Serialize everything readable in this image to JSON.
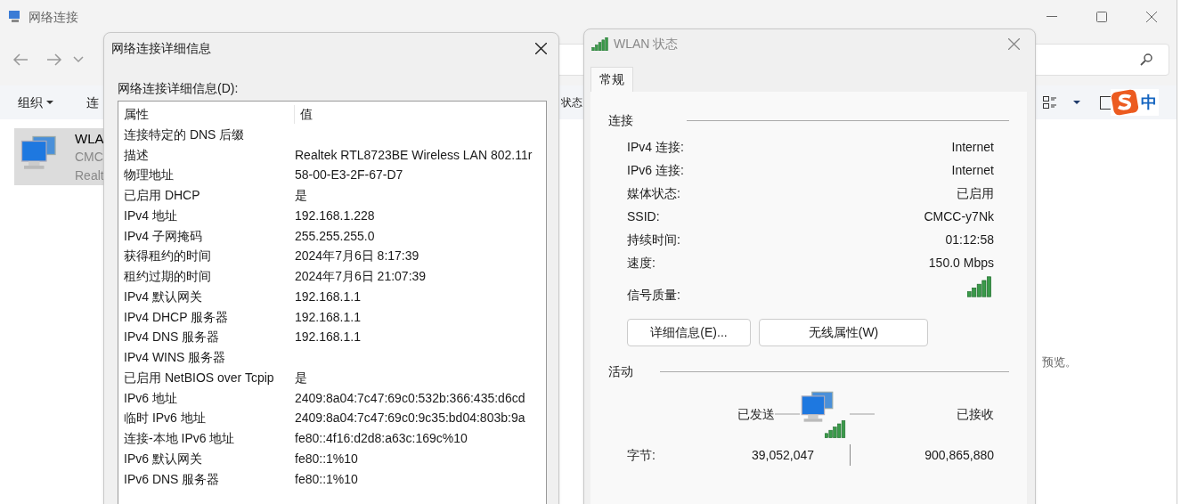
{
  "explorer": {
    "title": "网络连接",
    "toolbar": [
      {
        "label": "组织",
        "kind": "menu"
      },
      {
        "label": "连",
        "kind": "plain"
      },
      {
        "label": "状态",
        "kind": "plain"
      }
    ],
    "connection": {
      "name": "WLA",
      "line_2": "CMC",
      "line_3": "Realt",
      "selected": true
    },
    "preview_text": "预览。",
    "ime_label": "中"
  },
  "details_dialog": {
    "title": "网络连接详细信息",
    "list_label": "网络连接详细信息(D):",
    "columns": [
      "属性",
      "值"
    ],
    "rows": [
      {
        "property": "连接特定的 DNS 后缀"
      },
      {
        "property": "描述",
        "value": "Realtek RTL8723BE Wireless LAN 802.11r"
      },
      {
        "property": "物理地址",
        "value": "58-00-E3-2F-67-D7"
      },
      {
        "property": "已启用 DHCP",
        "value": "是"
      },
      {
        "property": "IPv4 地址",
        "value": "192.168.1.228"
      },
      {
        "property": "IPv4 子网掩码",
        "value": "255.255.255.0"
      },
      {
        "property": "获得租约的时间",
        "value": "2024年7月6日 8:17:39"
      },
      {
        "property": "租约过期的时间",
        "value": "2024年7月6日 21:07:39"
      },
      {
        "property": "IPv4 默认网关",
        "value": "192.168.1.1"
      },
      {
        "property": "IPv4 DHCP 服务器",
        "value": "192.168.1.1"
      },
      {
        "property": "IPv4 DNS 服务器",
        "value": "192.168.1.1"
      },
      {
        "property": "IPv4 WINS 服务器"
      },
      {
        "property": "已启用 NetBIOS over Tcpip",
        "value": "是"
      },
      {
        "property": "IPv6 地址",
        "value": "2409:8a04:7c47:69c0:532b:366:435:d6cd"
      },
      {
        "property": "临时 IPv6 地址",
        "value": "2409:8a04:7c47:69c0:9c35:bd04:803b:9a"
      },
      {
        "property": "连接-本地 IPv6 地址",
        "value": "fe80::4f16:d2d8:a63c:169c%10"
      },
      {
        "property": "IPv6 默认网关",
        "value": "fe80::1%10"
      },
      {
        "property": "IPv6 DNS 服务器",
        "value": "fe80::1%10"
      }
    ]
  },
  "status_dialog": {
    "title": "WLAN 状态",
    "tabs": [
      {
        "label": "常规",
        "selected": true
      }
    ],
    "connection_group": "连接",
    "fields": [
      {
        "label": "IPv4 连接:",
        "value": "Internet"
      },
      {
        "label": "IPv6 连接:",
        "value": "Internet"
      },
      {
        "label": "媒体状态:",
        "value": "已启用"
      },
      {
        "label": "SSID:",
        "value": "CMCC-y7Nk"
      },
      {
        "label": "持续时间:",
        "value": "01:12:58"
      },
      {
        "label": "速度:",
        "value": "150.0 Mbps"
      }
    ],
    "signal_label": "信号质量:",
    "buttons": [
      "详细信息(E)...",
      "无线属性(W)"
    ],
    "activity_group": "活动",
    "sent_label": "已发送",
    "received_label": "已接收",
    "bytes_label": "字节:",
    "bytes_sent": "39,052,047",
    "bytes_received": "900,865,880"
  }
}
